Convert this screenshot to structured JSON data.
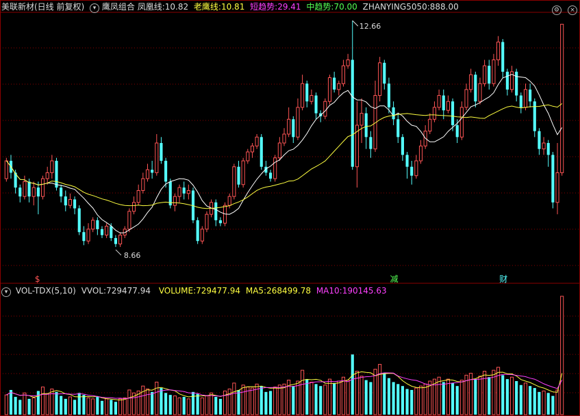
{
  "colors": {
    "up": "#ff5555",
    "down": "#54ffff",
    "ma_white": "#ffffff",
    "ma_yellow": "#ffff40",
    "magenta": "#ff40ff",
    "grid": "#8b0000"
  },
  "header": {
    "stock_name": "美联新材(日线 前复权)",
    "indicator_icon": "chevron-down-icon",
    "indicator_name": "鹰凤组合",
    "fh_label": "凤凰线:",
    "fh_value": "10.82",
    "lying_label": "老鹰线:",
    "lying_value": "10.81",
    "short_label": "短趋势:",
    "short_value": "29.41",
    "mid_label": "中趋势:",
    "mid_value": "70.00",
    "zy_label": "ZHANYING5050:",
    "zy_value": "888.00",
    "settings_icon": "gear-icon",
    "close_icon": "close-icon"
  },
  "price_panel": {
    "high_label": "12.66",
    "low_label": "8.66",
    "markers": [
      {
        "text": "$",
        "color": "#ff5555"
      },
      {
        "text": "减",
        "color": "#54ff54"
      },
      {
        "text": "财",
        "color": "#54ffff"
      }
    ]
  },
  "volume_panel": {
    "title": "VOL-TDX(5,10)",
    "vvol_label": "VVOL:",
    "vvol_value": "729477.94",
    "volume_label": "VOLUME:",
    "volume_value": "729477.94",
    "ma5_label": "MA5:",
    "ma5_value": "268499.78",
    "ma10_label": "MA10:",
    "ma10_value": "190145.63"
  },
  "chart_data": {
    "type": "candlestick",
    "ylim": [
      8.4,
      12.8
    ],
    "candles": [
      [
        10.0,
        10.3,
        10.35,
        9.95
      ],
      [
        10.3,
        10.1,
        10.4,
        10.0
      ],
      [
        10.1,
        9.85,
        10.15,
        9.75
      ],
      [
        9.85,
        9.7,
        9.9,
        9.6
      ],
      [
        9.7,
        9.95,
        10.05,
        9.65
      ],
      [
        9.95,
        9.7,
        10.0,
        9.6
      ],
      [
        9.7,
        9.85,
        9.95,
        9.55
      ],
      [
        9.85,
        9.7,
        9.95,
        9.4
      ],
      [
        9.7,
        10.0,
        10.05,
        9.65
      ],
      [
        10.0,
        10.1,
        10.2,
        9.9
      ],
      [
        10.1,
        10.3,
        10.4,
        10.0
      ],
      [
        10.3,
        9.85,
        10.35,
        9.8
      ],
      [
        9.85,
        9.7,
        9.9,
        9.6
      ],
      [
        9.7,
        9.55,
        9.8,
        9.45
      ],
      [
        9.55,
        9.65,
        9.75,
        9.5
      ],
      [
        9.65,
        9.5,
        9.7,
        9.4
      ],
      [
        9.5,
        9.1,
        9.55,
        9.05
      ],
      [
        9.1,
        8.95,
        9.2,
        8.88
      ],
      [
        8.95,
        9.15,
        9.25,
        8.9
      ],
      [
        9.15,
        9.3,
        9.35,
        9.1
      ],
      [
        9.3,
        9.15,
        9.35,
        9.05
      ],
      [
        9.15,
        9.05,
        9.2,
        9.0
      ],
      [
        9.05,
        9.2,
        9.25,
        9.0
      ],
      [
        9.2,
        9.0,
        9.25,
        8.95
      ],
      [
        9.0,
        8.9,
        9.05,
        8.85
      ],
      [
        8.9,
        9.05,
        9.1,
        8.85
      ],
      [
        9.05,
        9.15,
        9.2,
        9.0
      ],
      [
        9.15,
        9.45,
        9.5,
        9.1
      ],
      [
        9.45,
        9.6,
        9.7,
        9.4
      ],
      [
        9.6,
        9.8,
        9.9,
        9.55
      ],
      [
        9.8,
        10.0,
        10.1,
        9.75
      ],
      [
        10.0,
        10.15,
        10.25,
        9.95
      ],
      [
        10.15,
        10.1,
        10.3,
        10.0
      ],
      [
        10.1,
        10.6,
        10.75,
        10.05
      ],
      [
        10.6,
        10.3,
        10.7,
        10.25
      ],
      [
        10.3,
        9.95,
        10.35,
        9.85
      ],
      [
        9.95,
        9.55,
        10.0,
        9.5
      ],
      [
        9.55,
        9.7,
        9.75,
        9.45
      ],
      [
        9.7,
        9.85,
        9.9,
        9.6
      ],
      [
        9.85,
        9.75,
        9.95,
        9.65
      ],
      [
        9.75,
        9.8,
        9.9,
        9.65
      ],
      [
        9.8,
        9.3,
        9.85,
        9.25
      ],
      [
        9.3,
        8.95,
        9.35,
        8.9
      ],
      [
        8.95,
        9.15,
        9.2,
        8.9
      ],
      [
        9.15,
        9.4,
        9.45,
        9.1
      ],
      [
        9.4,
        9.6,
        9.65,
        9.35
      ],
      [
        9.6,
        9.3,
        9.65,
        9.2
      ],
      [
        9.3,
        9.25,
        9.35,
        9.2
      ],
      [
        9.25,
        9.55,
        9.6,
        9.2
      ],
      [
        9.55,
        9.7,
        9.75,
        9.5
      ],
      [
        9.7,
        10.2,
        10.25,
        9.65
      ],
      [
        10.2,
        9.9,
        10.3,
        9.85
      ],
      [
        9.9,
        10.3,
        10.35,
        9.85
      ],
      [
        10.3,
        10.45,
        10.5,
        10.25
      ],
      [
        10.45,
        10.55,
        10.6,
        10.35
      ],
      [
        10.55,
        10.7,
        10.75,
        10.5
      ],
      [
        10.7,
        10.2,
        10.75,
        10.15
      ],
      [
        10.2,
        10.1,
        10.3,
        10.05
      ],
      [
        10.1,
        10.0,
        10.15,
        9.95
      ],
      [
        10.0,
        10.35,
        10.4,
        9.95
      ],
      [
        10.35,
        10.6,
        10.7,
        10.3
      ],
      [
        10.6,
        10.75,
        10.85,
        10.55
      ],
      [
        10.75,
        11.0,
        11.2,
        10.7
      ],
      [
        11.0,
        10.7,
        11.05,
        10.6
      ],
      [
        10.7,
        11.2,
        11.35,
        10.65
      ],
      [
        11.2,
        11.6,
        11.75,
        11.15
      ],
      [
        11.6,
        11.3,
        11.65,
        11.2
      ],
      [
        11.3,
        11.4,
        11.5,
        11.25
      ],
      [
        11.4,
        11.1,
        11.45,
        11.0
      ],
      [
        11.1,
        11.05,
        11.15,
        10.95
      ],
      [
        11.05,
        11.3,
        11.35,
        11.0
      ],
      [
        11.3,
        11.7,
        11.75,
        11.25
      ],
      [
        11.7,
        11.5,
        11.8,
        11.45
      ],
      [
        11.5,
        11.6,
        11.65,
        11.4
      ],
      [
        11.6,
        11.9,
        12.0,
        11.55
      ],
      [
        11.9,
        12.0,
        12.1,
        11.85
      ],
      [
        12.0,
        10.2,
        12.66,
        10.15
      ],
      [
        10.2,
        10.9,
        11.3,
        9.85
      ],
      [
        10.9,
        11.1,
        11.35,
        10.6
      ],
      [
        11.1,
        10.7,
        11.2,
        10.5
      ],
      [
        10.7,
        10.5,
        10.8,
        10.35
      ],
      [
        10.5,
        11.4,
        11.65,
        10.45
      ],
      [
        11.4,
        11.95,
        12.05,
        11.3
      ],
      [
        11.95,
        11.6,
        12.0,
        11.5
      ],
      [
        11.6,
        11.2,
        11.7,
        11.1
      ],
      [
        11.2,
        11.0,
        11.3,
        10.9
      ],
      [
        11.0,
        10.7,
        11.1,
        10.6
      ],
      [
        10.7,
        10.4,
        10.75,
        10.3
      ],
      [
        10.4,
        10.2,
        10.45,
        10.0
      ],
      [
        10.2,
        10.05,
        10.3,
        9.9
      ],
      [
        10.05,
        10.3,
        10.4,
        10.0
      ],
      [
        10.3,
        10.55,
        10.65,
        10.25
      ],
      [
        10.55,
        10.8,
        10.9,
        10.5
      ],
      [
        10.8,
        11.0,
        11.1,
        10.75
      ],
      [
        11.0,
        11.2,
        11.3,
        10.95
      ],
      [
        11.2,
        11.4,
        11.5,
        11.15
      ],
      [
        11.4,
        11.15,
        11.5,
        11.0
      ],
      [
        11.15,
        11.3,
        11.4,
        11.1
      ],
      [
        11.3,
        10.9,
        11.35,
        10.8
      ],
      [
        10.9,
        10.7,
        11.0,
        10.6
      ],
      [
        10.7,
        11.2,
        11.3,
        10.65
      ],
      [
        11.2,
        11.5,
        11.6,
        11.15
      ],
      [
        11.5,
        11.75,
        11.85,
        11.45
      ],
      [
        11.75,
        11.3,
        11.8,
        11.2
      ],
      [
        11.3,
        11.6,
        11.7,
        11.25
      ],
      [
        11.6,
        11.9,
        12.0,
        11.55
      ],
      [
        11.9,
        11.6,
        12.0,
        11.5
      ],
      [
        11.6,
        12.0,
        12.1,
        11.55
      ],
      [
        12.0,
        12.3,
        12.4,
        11.9
      ],
      [
        12.3,
        11.8,
        12.35,
        11.7
      ],
      [
        11.8,
        11.5,
        11.85,
        11.4
      ],
      [
        11.5,
        11.8,
        11.9,
        11.45
      ],
      [
        11.8,
        11.4,
        11.85,
        11.3
      ],
      [
        11.4,
        11.2,
        11.45,
        11.1
      ],
      [
        11.2,
        11.5,
        11.6,
        11.15
      ],
      [
        11.5,
        11.3,
        11.6,
        11.2
      ],
      [
        11.3,
        10.8,
        11.35,
        10.7
      ],
      [
        10.8,
        10.5,
        10.85,
        10.4
      ],
      [
        10.5,
        10.6,
        10.7,
        10.4
      ],
      [
        10.6,
        10.4,
        10.65,
        10.2
      ],
      [
        10.4,
        9.6,
        10.45,
        9.5
      ],
      [
        9.6,
        10.1,
        10.6,
        9.4
      ],
      [
        10.1,
        12.6,
        12.6,
        10.05
      ]
    ],
    "vol": [
      2,
      2.5,
      1.8,
      1.5,
      2.2,
      1.6,
      1.7,
      2.4,
      2.8,
      2.1,
      2.6,
      2.3,
      1.9,
      1.6,
      1.8,
      1.5,
      2.2,
      2.0,
      1.7,
      1.6,
      1.8,
      1.4,
      1.6,
      1.5,
      1.3,
      1.6,
      1.7,
      2.5,
      2.2,
      2.4,
      2.9,
      2.6,
      2.3,
      3.3,
      2.7,
      2.2,
      2.0,
      1.9,
      1.7,
      1.8,
      1.6,
      2.3,
      2.1,
      1.7,
      1.9,
      2.2,
      1.8,
      1.6,
      2.4,
      2.6,
      3.2,
      2.5,
      3.0,
      2.8,
      2.7,
      3.1,
      2.9,
      2.3,
      2.4,
      2.8,
      3.0,
      3.1,
      3.5,
      2.9,
      3.4,
      4.5,
      3.6,
      3.3,
      3.1,
      2.9,
      3.0,
      3.6,
      3.2,
      3.4,
      3.8,
      3.5,
      6.1,
      4.4,
      3.9,
      3.5,
      3.3,
      4.6,
      5.1,
      4.2,
      3.7,
      3.3,
      3.1,
      2.9,
      2.6,
      2.5,
      2.7,
      2.9,
      3.1,
      3.4,
      3.6,
      3.8,
      3.3,
      3.6,
      3.2,
      2.9,
      3.5,
      4.0,
      4.2,
      3.6,
      3.9,
      4.4,
      3.8,
      4.5,
      4.8,
      4.0,
      3.6,
      3.8,
      3.4,
      3.0,
      3.2,
      2.9,
      2.7,
      2.3,
      2.4,
      2.2,
      1.9,
      2.5,
      12.0
    ]
  }
}
